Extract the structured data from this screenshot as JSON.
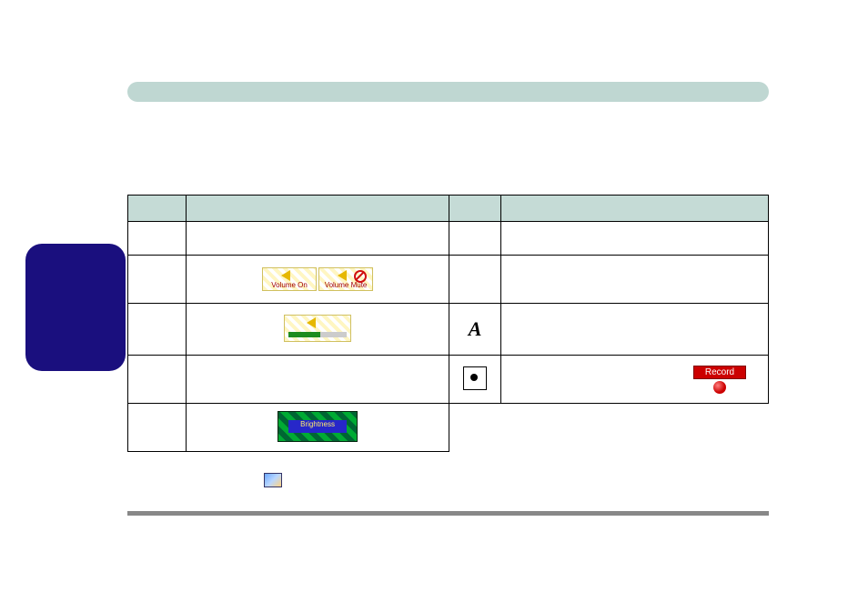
{
  "banner": {
    "title": ""
  },
  "table": {
    "header": {
      "a": "",
      "b": "",
      "c": "",
      "d": ""
    },
    "rows": [
      {
        "a": "",
        "b": "",
        "c": "",
        "d": ""
      },
      {
        "a": "",
        "b_icon1_label": "Volume   On",
        "b_icon2_label": "Volume   Mute",
        "c": "",
        "d": ""
      },
      {
        "a": "",
        "b_slider": "volume-slider",
        "c_text": "A",
        "d": ""
      },
      {
        "a": "",
        "b": "",
        "c_icon": "record-dot",
        "d_badge": "Record"
      },
      {
        "a": "",
        "b_brightness": "Brightness"
      }
    ]
  },
  "footer": {
    "thumb_alt": "wallpaper-thumbnail"
  }
}
